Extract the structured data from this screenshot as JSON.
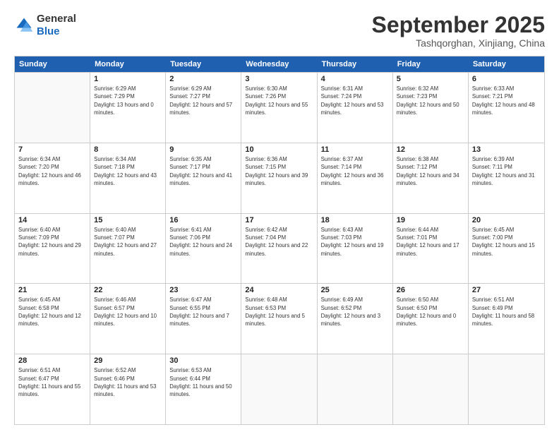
{
  "logo": {
    "general": "General",
    "blue": "Blue"
  },
  "header": {
    "month": "September 2025",
    "location": "Tashqorghan, Xinjiang, China"
  },
  "days": [
    "Sunday",
    "Monday",
    "Tuesday",
    "Wednesday",
    "Thursday",
    "Friday",
    "Saturday"
  ],
  "rows": [
    [
      {
        "day": "",
        "empty": true
      },
      {
        "day": "1",
        "sunrise": "Sunrise: 6:29 AM",
        "sunset": "Sunset: 7:29 PM",
        "daylight": "Daylight: 13 hours and 0 minutes."
      },
      {
        "day": "2",
        "sunrise": "Sunrise: 6:29 AM",
        "sunset": "Sunset: 7:27 PM",
        "daylight": "Daylight: 12 hours and 57 minutes."
      },
      {
        "day": "3",
        "sunrise": "Sunrise: 6:30 AM",
        "sunset": "Sunset: 7:26 PM",
        "daylight": "Daylight: 12 hours and 55 minutes."
      },
      {
        "day": "4",
        "sunrise": "Sunrise: 6:31 AM",
        "sunset": "Sunset: 7:24 PM",
        "daylight": "Daylight: 12 hours and 53 minutes."
      },
      {
        "day": "5",
        "sunrise": "Sunrise: 6:32 AM",
        "sunset": "Sunset: 7:23 PM",
        "daylight": "Daylight: 12 hours and 50 minutes."
      },
      {
        "day": "6",
        "sunrise": "Sunrise: 6:33 AM",
        "sunset": "Sunset: 7:21 PM",
        "daylight": "Daylight: 12 hours and 48 minutes."
      }
    ],
    [
      {
        "day": "7",
        "sunrise": "Sunrise: 6:34 AM",
        "sunset": "Sunset: 7:20 PM",
        "daylight": "Daylight: 12 hours and 46 minutes."
      },
      {
        "day": "8",
        "sunrise": "Sunrise: 6:34 AM",
        "sunset": "Sunset: 7:18 PM",
        "daylight": "Daylight: 12 hours and 43 minutes."
      },
      {
        "day": "9",
        "sunrise": "Sunrise: 6:35 AM",
        "sunset": "Sunset: 7:17 PM",
        "daylight": "Daylight: 12 hours and 41 minutes."
      },
      {
        "day": "10",
        "sunrise": "Sunrise: 6:36 AM",
        "sunset": "Sunset: 7:15 PM",
        "daylight": "Daylight: 12 hours and 39 minutes."
      },
      {
        "day": "11",
        "sunrise": "Sunrise: 6:37 AM",
        "sunset": "Sunset: 7:14 PM",
        "daylight": "Daylight: 12 hours and 36 minutes."
      },
      {
        "day": "12",
        "sunrise": "Sunrise: 6:38 AM",
        "sunset": "Sunset: 7:12 PM",
        "daylight": "Daylight: 12 hours and 34 minutes."
      },
      {
        "day": "13",
        "sunrise": "Sunrise: 6:39 AM",
        "sunset": "Sunset: 7:11 PM",
        "daylight": "Daylight: 12 hours and 31 minutes."
      }
    ],
    [
      {
        "day": "14",
        "sunrise": "Sunrise: 6:40 AM",
        "sunset": "Sunset: 7:09 PM",
        "daylight": "Daylight: 12 hours and 29 minutes."
      },
      {
        "day": "15",
        "sunrise": "Sunrise: 6:40 AM",
        "sunset": "Sunset: 7:07 PM",
        "daylight": "Daylight: 12 hours and 27 minutes."
      },
      {
        "day": "16",
        "sunrise": "Sunrise: 6:41 AM",
        "sunset": "Sunset: 7:06 PM",
        "daylight": "Daylight: 12 hours and 24 minutes."
      },
      {
        "day": "17",
        "sunrise": "Sunrise: 6:42 AM",
        "sunset": "Sunset: 7:04 PM",
        "daylight": "Daylight: 12 hours and 22 minutes."
      },
      {
        "day": "18",
        "sunrise": "Sunrise: 6:43 AM",
        "sunset": "Sunset: 7:03 PM",
        "daylight": "Daylight: 12 hours and 19 minutes."
      },
      {
        "day": "19",
        "sunrise": "Sunrise: 6:44 AM",
        "sunset": "Sunset: 7:01 PM",
        "daylight": "Daylight: 12 hours and 17 minutes."
      },
      {
        "day": "20",
        "sunrise": "Sunrise: 6:45 AM",
        "sunset": "Sunset: 7:00 PM",
        "daylight": "Daylight: 12 hours and 15 minutes."
      }
    ],
    [
      {
        "day": "21",
        "sunrise": "Sunrise: 6:45 AM",
        "sunset": "Sunset: 6:58 PM",
        "daylight": "Daylight: 12 hours and 12 minutes."
      },
      {
        "day": "22",
        "sunrise": "Sunrise: 6:46 AM",
        "sunset": "Sunset: 6:57 PM",
        "daylight": "Daylight: 12 hours and 10 minutes."
      },
      {
        "day": "23",
        "sunrise": "Sunrise: 6:47 AM",
        "sunset": "Sunset: 6:55 PM",
        "daylight": "Daylight: 12 hours and 7 minutes."
      },
      {
        "day": "24",
        "sunrise": "Sunrise: 6:48 AM",
        "sunset": "Sunset: 6:53 PM",
        "daylight": "Daylight: 12 hours and 5 minutes."
      },
      {
        "day": "25",
        "sunrise": "Sunrise: 6:49 AM",
        "sunset": "Sunset: 6:52 PM",
        "daylight": "Daylight: 12 hours and 3 minutes."
      },
      {
        "day": "26",
        "sunrise": "Sunrise: 6:50 AM",
        "sunset": "Sunset: 6:50 PM",
        "daylight": "Daylight: 12 hours and 0 minutes."
      },
      {
        "day": "27",
        "sunrise": "Sunrise: 6:51 AM",
        "sunset": "Sunset: 6:49 PM",
        "daylight": "Daylight: 11 hours and 58 minutes."
      }
    ],
    [
      {
        "day": "28",
        "sunrise": "Sunrise: 6:51 AM",
        "sunset": "Sunset: 6:47 PM",
        "daylight": "Daylight: 11 hours and 55 minutes."
      },
      {
        "day": "29",
        "sunrise": "Sunrise: 6:52 AM",
        "sunset": "Sunset: 6:46 PM",
        "daylight": "Daylight: 11 hours and 53 minutes."
      },
      {
        "day": "30",
        "sunrise": "Sunrise: 6:53 AM",
        "sunset": "Sunset: 6:44 PM",
        "daylight": "Daylight: 11 hours and 50 minutes."
      },
      {
        "day": "",
        "empty": true
      },
      {
        "day": "",
        "empty": true
      },
      {
        "day": "",
        "empty": true
      },
      {
        "day": "",
        "empty": true
      }
    ]
  ]
}
